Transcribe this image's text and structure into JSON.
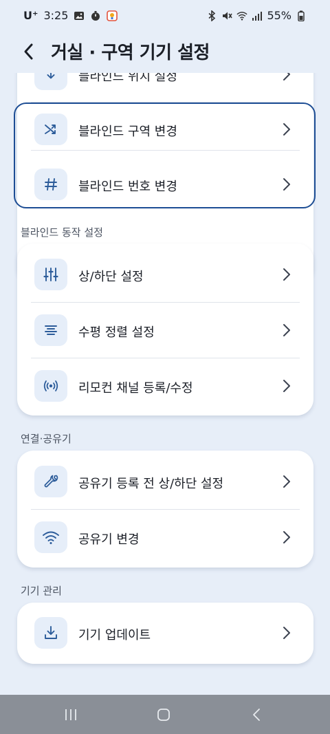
{
  "status_bar": {
    "carrier": "U⁺",
    "time": "3:25",
    "battery": "55%"
  },
  "header": {
    "title": "거실 · 구역 기기 설정"
  },
  "sections": [
    {
      "label": "",
      "rows": [
        {
          "label": "블라인드 위치 설정",
          "icon": "blind-position-icon"
        },
        {
          "label": "블라인드 구역 변경",
          "icon": "shuffle-icon"
        },
        {
          "label": "블라인드 번호 변경",
          "icon": "hash-icon"
        }
      ]
    },
    {
      "label": "블라인드 동작 설정",
      "rows": [
        {
          "label": "상/하단 설정",
          "icon": "sliders-icon"
        },
        {
          "label": "수평 정렬 설정",
          "icon": "align-center-icon"
        },
        {
          "label": "리모컨 채널 등록/수정",
          "icon": "broadcast-icon"
        }
      ]
    },
    {
      "label": "연결·공유기",
      "rows": [
        {
          "label": "공유기 등록 전 상/하단 설정",
          "icon": "wrench-icon"
        },
        {
          "label": "공유기 변경",
          "icon": "wifi-icon"
        }
      ]
    },
    {
      "label": "기기 관리",
      "rows": [
        {
          "label": "기기 업데이트",
          "icon": "download-icon"
        }
      ]
    }
  ],
  "colors": {
    "background": "#e7eef8",
    "card": "#ffffff",
    "icon_tint": "#2c5c9a",
    "icon_box": "#e6eef9",
    "highlight_border": "#1d4d94",
    "navbar": "#8a8f97"
  }
}
